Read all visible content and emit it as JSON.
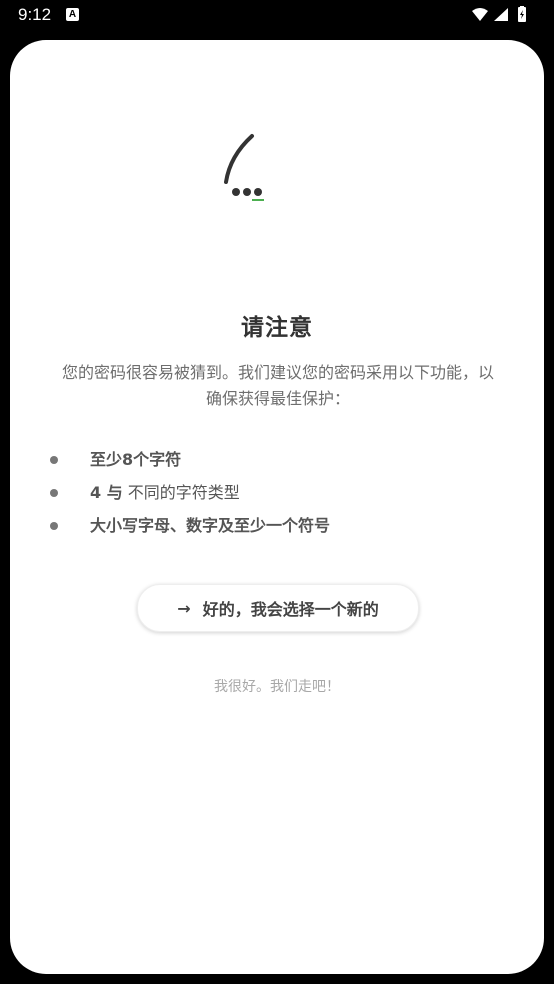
{
  "status_bar": {
    "time": "9:12",
    "notification_icon_letter": "A",
    "icons": [
      "wifi-icon",
      "cellular-signal-icon",
      "battery-icon"
    ]
  },
  "dialog": {
    "title": "请注意",
    "description": "您的密码很容易被猜到。我们建议您的密码采用以下功能，以确保获得最佳保护：",
    "requirements": [
      {
        "prefix": "至少",
        "number": "8",
        "suffix": "个字符"
      },
      {
        "prefix": "",
        "number": "4",
        "suffix": " 与",
        "rest": "  不同的字符类型"
      },
      {
        "prefix": "大小写字母、数字及至少一个符号",
        "number": "",
        "suffix": ""
      }
    ],
    "primary_button": {
      "icon": "arrow-right-icon",
      "label": "好的，我会选择一个新的"
    },
    "secondary_link": "我很好。我们走吧！"
  },
  "colors": {
    "title": "#333333",
    "body": "#6e6e6e",
    "accent_underline": "#4caf50",
    "secondary": "#a8a8a8"
  }
}
